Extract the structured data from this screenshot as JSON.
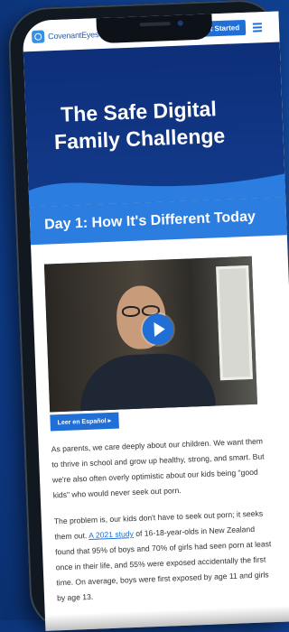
{
  "header": {
    "brand": "CovenantEyes",
    "cta_label": "Get Started"
  },
  "hero": {
    "title": "The Safe Digital Family Challenge"
  },
  "section": {
    "title": "Day 1: How It's Different Today"
  },
  "video": {
    "language_button": "Leer en Español ▸"
  },
  "body": {
    "paragraph_1": "As parents, we care deeply about our children. We want them to thrive in school and grow up healthy, strong, and smart. But we're also often overly optimistic about our kids being \"good kids\" who would never seek out porn.",
    "paragraph_2_before_link": "The problem is, our kids don't have to seek out porn; it seeks them out. ",
    "paragraph_2_link": "A 2021 study",
    "paragraph_2_after_link": " of 16-18-year-olds in New Zealand found that 95% of boys and 70% of girls had seen porn at least once in their life, and 55% were exposed accidentally the first time. On average, boys were first exposed by age 11 and girls by age 13."
  },
  "colors": {
    "accent_blue": "#1f6fd6",
    "hero_navy": "#0e2f7a",
    "background_blue": "#1553a8"
  },
  "icons": {
    "menu": "hamburger-menu-icon",
    "play": "play-icon",
    "logo": "covenant-eyes-logo-icon"
  }
}
